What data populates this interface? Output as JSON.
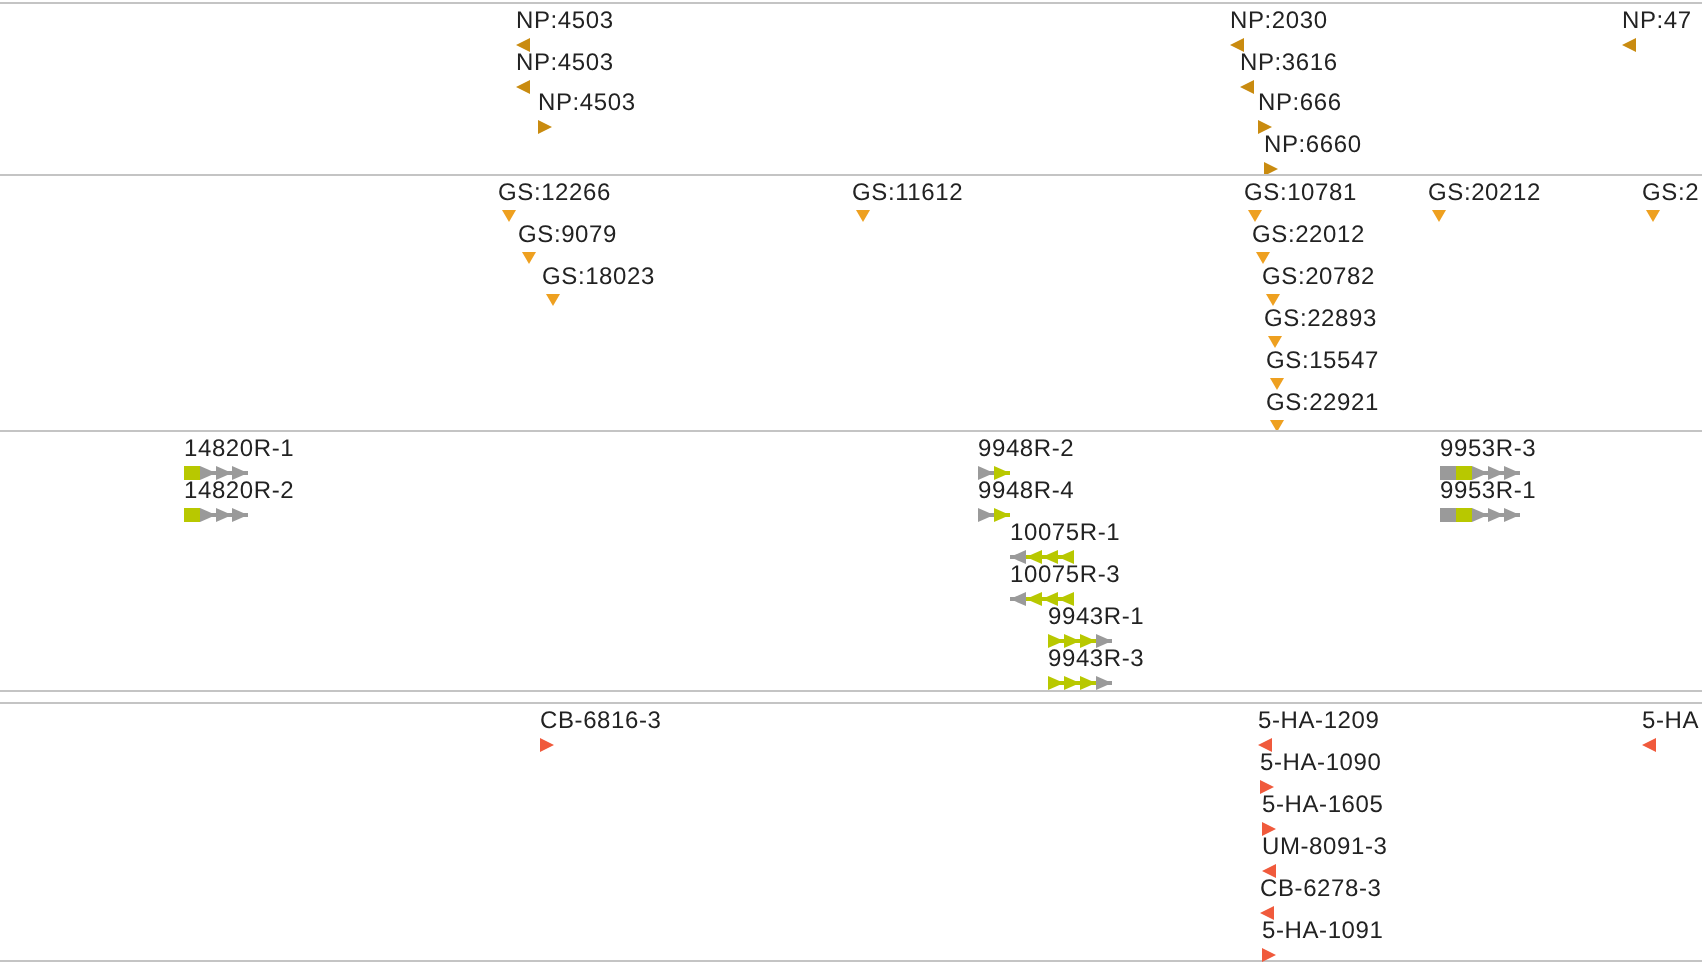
{
  "tracks": [
    {
      "kind": "marker",
      "color": "#c98b10",
      "features": [
        {
          "label": "NP:4503",
          "reverse": true
        },
        {
          "label": "NP:4503",
          "reverse": true
        },
        {
          "label": "NP:4503",
          "reverse": false
        },
        {
          "label": "NP:2030",
          "reverse": true
        },
        {
          "label": "NP:3616",
          "reverse": true
        },
        {
          "label": "NP:666",
          "reverse": false
        },
        {
          "label": "NP:6660",
          "reverse": false
        },
        {
          "label": "NP:47",
          "reverse": true
        }
      ]
    },
    {
      "kind": "site",
      "color": "#eea020",
      "features": [
        {
          "label": "GS:12266"
        },
        {
          "label": "GS:9079"
        },
        {
          "label": "GS:18023"
        },
        {
          "label": "GS:11612"
        },
        {
          "label": "GS:10781"
        },
        {
          "label": "GS:22012"
        },
        {
          "label": "GS:20782"
        },
        {
          "label": "GS:22893"
        },
        {
          "label": "GS:15547"
        },
        {
          "label": "GS:22921"
        },
        {
          "label": "GS:20212"
        },
        {
          "label": "GS:2"
        }
      ]
    },
    {
      "kind": "gene",
      "color": "#b8c800",
      "features": [
        {
          "label": "14820R-1",
          "reverse": false
        },
        {
          "label": "14820R-2",
          "reverse": false
        },
        {
          "label": "9948R-2",
          "reverse": false
        },
        {
          "label": "9948R-4",
          "reverse": false
        },
        {
          "label": "10075R-1",
          "reverse": true
        },
        {
          "label": "10075R-3",
          "reverse": true
        },
        {
          "label": "9943R-1",
          "reverse": false
        },
        {
          "label": "9943R-3",
          "reverse": false
        },
        {
          "label": "9953R-3",
          "reverse": false
        },
        {
          "label": "9953R-1",
          "reverse": false
        }
      ]
    },
    {
      "kind": "spacer"
    },
    {
      "kind": "marker",
      "color": "#f05a3c",
      "features": [
        {
          "label": "CB-6816-3",
          "reverse": false
        },
        {
          "label": "5-HA-1209",
          "reverse": true
        },
        {
          "label": "5-HA-1090",
          "reverse": false
        },
        {
          "label": "5-HA-1605",
          "reverse": false
        },
        {
          "label": "UM-8091-3",
          "reverse": true
        },
        {
          "label": "CB-6278-3",
          "reverse": true
        },
        {
          "label": "5-HA-1091",
          "reverse": false
        },
        {
          "label": "5-HA",
          "reverse": true
        }
      ]
    }
  ]
}
